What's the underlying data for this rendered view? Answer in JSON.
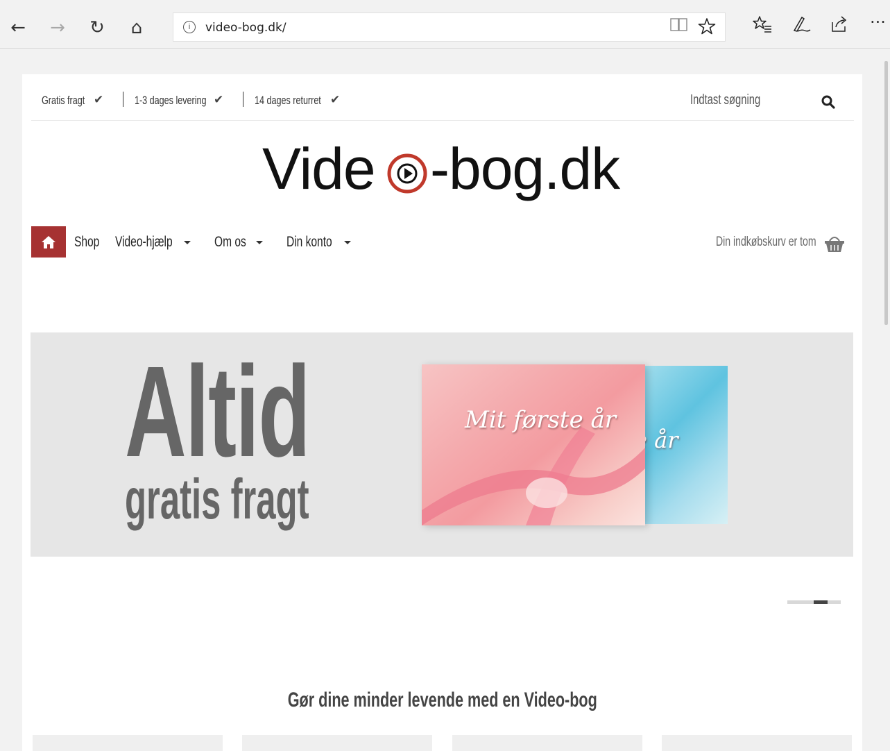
{
  "browser": {
    "back": "←",
    "forward": "→",
    "refresh": "↻",
    "home": "⌂",
    "address": "video-bog.dk/",
    "info_icon": "i",
    "reading_view": "📖",
    "favorite": "☆",
    "favorites_hub": "☆≡",
    "notes": "✎",
    "share": "⇪",
    "more": "···"
  },
  "usp": {
    "items": [
      "Gratis fragt",
      "1-3 dages levering",
      "14 dages returret"
    ],
    "check": "✔"
  },
  "search": {
    "label": "Indtast søgning"
  },
  "logo": {
    "part1": "Vide",
    "part2": "-bog.dk"
  },
  "menu": {
    "items": [
      "Shop",
      "Video-hjælp",
      "Om os",
      "Din konto"
    ],
    "cart": "Din indkøbskurv er tom"
  },
  "banner": {
    "headline": "Altid",
    "subline": "gratis fragt",
    "book_title": "Mit første år",
    "book_title_back": "e år"
  },
  "slider": {
    "active_index": 1,
    "count": 2
  },
  "section": {
    "heading": "Gør dine minder levende med en Video-bog"
  },
  "colors": {
    "accent": "#a63232",
    "banner_text": "#666666",
    "logo_play": "#c0392b"
  }
}
